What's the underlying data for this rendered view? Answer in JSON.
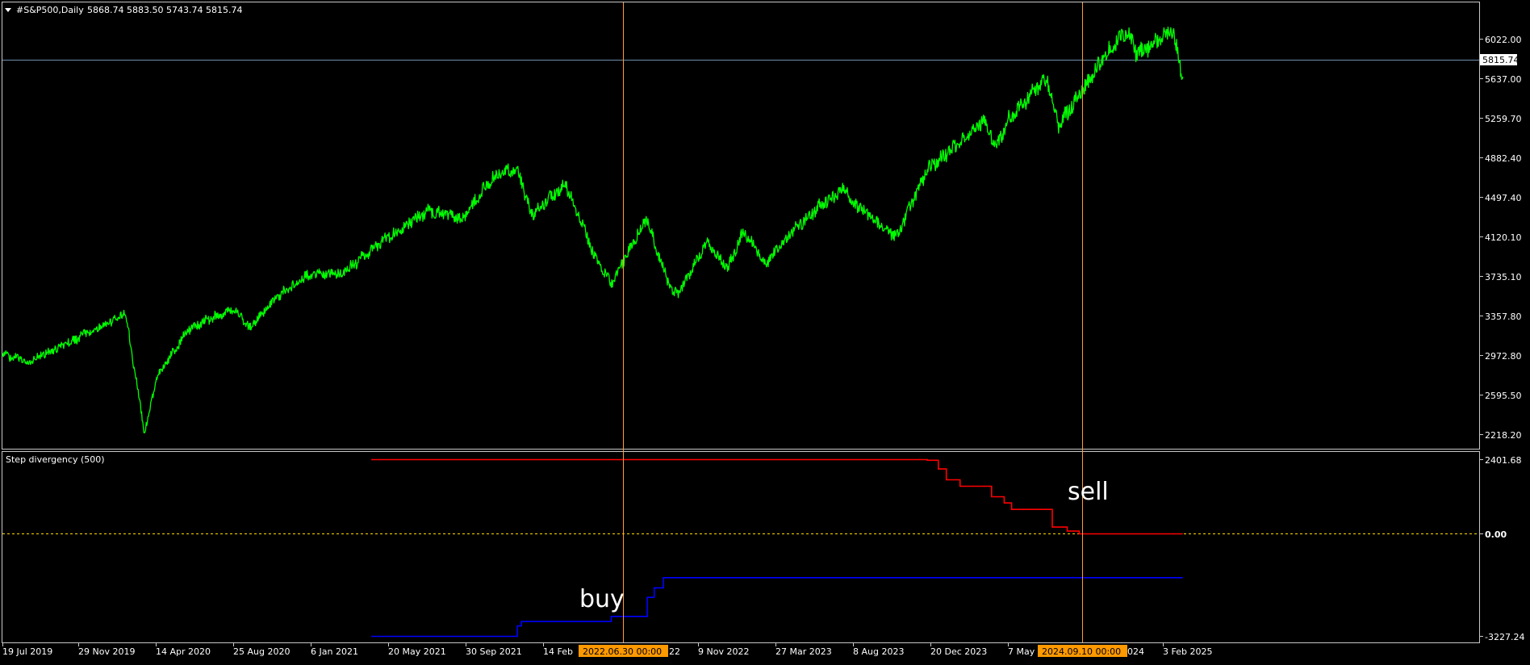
{
  "header": {
    "symbol_label": "#S&P500,Daily",
    "ohlc": "5868.74 5883.50 5743.74 5815.74"
  },
  "price_axis": {
    "ticks": [
      "6022.00",
      "5637.00",
      "5259.70",
      "4882.40",
      "4497.40",
      "4120.10",
      "3735.10",
      "3357.80",
      "2972.80",
      "2595.50",
      "2218.20"
    ],
    "current_price_label": "5815.74"
  },
  "indicator": {
    "title": "Step divergency (500)",
    "ticks": [
      "2401.68",
      "0.00",
      "-3227.24"
    ],
    "annotations": {
      "buy": "buy",
      "sell": "sell"
    }
  },
  "time_axis": {
    "ticks": [
      "19 Jul 2019",
      "29 Nov 2019",
      "14 Apr 2020",
      "25 Aug 2020",
      "6 Jan 2021",
      "20 May 2021",
      "30 Sep 2021",
      "14 Feb",
      "22",
      "9 Nov 2022",
      "27 Mar 2023",
      "8 Aug 2023",
      "20 Dec 2023",
      "7 May",
      "024",
      "3 Feb 2025"
    ],
    "highlight_labels": [
      "2022.06.30 00:00",
      "2024.09.10 00:00"
    ]
  },
  "colors": {
    "price_line": "#00ff00",
    "indicator_upper": "#ff0000",
    "indicator_lower": "#0000ff",
    "crosshair": "#ff9d33",
    "price_level_line": "#6f8fae",
    "zero_line": "#ffd800",
    "highlight_bg": "#ff9900",
    "frame": "#c8c8c8",
    "background": "#000000"
  },
  "chart_data": [
    {
      "type": "line",
      "name": "#S&P500,Daily",
      "ylim": [
        2218.2,
        6200
      ],
      "x": [
        "2019-07-19",
        "2019-09-01",
        "2019-11-29",
        "2020-02-19",
        "2020-03-23",
        "2020-04-14",
        "2020-06-08",
        "2020-08-25",
        "2020-09-23",
        "2020-11-09",
        "2021-01-06",
        "2021-03-04",
        "2021-05-20",
        "2021-08-01",
        "2021-09-30",
        "2021-11-20",
        "2022-01-03",
        "2022-01-27",
        "2022-03-29",
        "2022-05-20",
        "2022-06-16",
        "2022-08-16",
        "2022-09-30",
        "2022-10-12",
        "2022-11-30",
        "2023-01-05",
        "2023-02-02",
        "2023-03-13",
        "2023-04-28",
        "2023-06-15",
        "2023-07-31",
        "2023-08-08",
        "2023-10-27",
        "2023-12-20",
        "2024-02-15",
        "2024-03-28",
        "2024-04-19",
        "2024-05-07",
        "2024-07-16",
        "2024-08-05",
        "2024-09-10",
        "2024-11-11",
        "2024-12-06",
        "2024-12-19",
        "2025-02-03",
        "2025-02-19",
        "2025-03-10"
      ],
      "y": [
        2990,
        2920,
        3150,
        3390,
        2237,
        2780,
        3230,
        3440,
        3240,
        3540,
        3760,
        3770,
        4110,
        4370,
        4300,
        4690,
        4790,
        4330,
        4630,
        3900,
        3670,
        4300,
        3590,
        3580,
        4080,
        3810,
        4180,
        3860,
        4170,
        4420,
        4590,
        4470,
        4120,
        4770,
        5030,
        5260,
        4970,
        5240,
        5660,
        5190,
        5480,
        6000,
        6090,
        5870,
        6050,
        6120,
        5650
      ]
    },
    {
      "type": "line",
      "title": "Step divergency (500)",
      "ylim": [
        -3227.24,
        2401.68
      ],
      "series": [
        {
          "x": [
            "2021-04-23",
            "2023-12-01",
            "2023-12-20",
            "2024-01-08",
            "2024-01-22",
            "2024-02-15",
            "2024-04-01",
            "2024-04-10",
            "2024-05-02",
            "2024-05-15",
            "2024-07-16",
            "2024-07-25",
            "2024-08-20",
            "2024-09-10",
            "2025-03-10"
          ],
          "values": [
            2401.68,
            2401.68,
            2380,
            2100,
            1750,
            1540,
            1540,
            1200,
            1000,
            790,
            790,
            220,
            90,
            0,
            0
          ]
        },
        {
          "x": [
            "2021-04-23",
            "2021-12-28",
            "2022-01-03",
            "2022-01-10",
            "2022-05-20",
            "2022-06-16",
            "2022-08-01",
            "2022-08-18",
            "2022-08-30",
            "2022-09-15",
            "2025-03-10"
          ],
          "values": [
            -3227.24,
            -3227.24,
            -2900,
            -2760,
            -2760,
            -2600,
            -2600,
            -2000,
            -1700,
            -1380,
            -1380
          ]
        }
      ]
    }
  ]
}
